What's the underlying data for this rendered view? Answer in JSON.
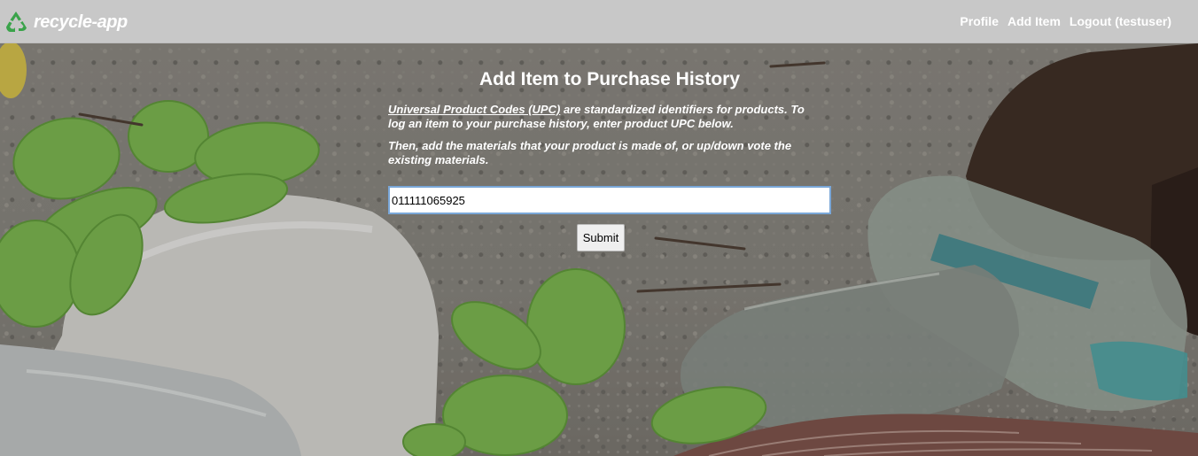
{
  "navbar": {
    "brand": "recycle-app",
    "logo_icon": "recycle-icon",
    "links": {
      "profile": "Profile",
      "add_item": "Add Item",
      "logout": "Logout (testuser)"
    },
    "background": "#c8c8c8"
  },
  "form": {
    "title": "Add Item to Purchase History",
    "upc_link_text": "Universal Product Codes (UPC)",
    "intro_rest": " are standardized identifiers for products. To log an item to your purchase history, enter product UPC below.",
    "instructions": "Then, add the materials that your product is made of, or up/down vote the existing materials.",
    "upc_value": "011111065925",
    "submit_label": "Submit"
  },
  "colors": {
    "recycle_green": "#3aa34a",
    "input_focus_border": "#7aa7d8"
  }
}
